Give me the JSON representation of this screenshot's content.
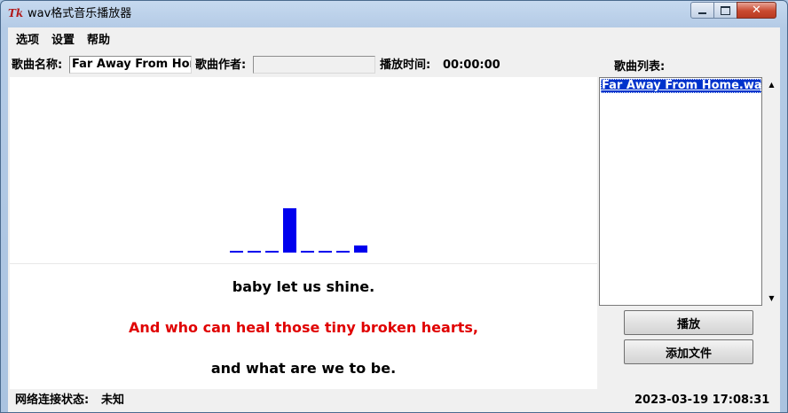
{
  "window": {
    "title": "wav格式音乐播放器",
    "app_icon_glyph": "Tk",
    "close_glyph": "✕"
  },
  "menu": {
    "items": [
      "选项",
      "设置",
      "帮助"
    ]
  },
  "info": {
    "song_name_label": "歌曲名称:",
    "song_name_value": "Far Away From Home.wav",
    "artist_label": "歌曲作者:",
    "artist_value": "",
    "play_time_label": "播放时间:",
    "play_time_value": "00:00:00",
    "playlist_label": "歌曲列表:"
  },
  "visualizer": {
    "bar_color": "#0000ee",
    "levels": [
      0.04,
      0.04,
      0.04,
      1.0,
      0.04,
      0.04,
      0.04,
      0.16
    ]
  },
  "lyrics": [
    {
      "text": "baby let us shine.",
      "color": "#000000"
    },
    {
      "text": "And who can heal those tiny broken hearts,",
      "color": "#e00000"
    },
    {
      "text": "and what are we to be.",
      "color": "#000000"
    }
  ],
  "playlist": {
    "items": [
      "Far Away From Home.wav"
    ],
    "selected_index": 0
  },
  "buttons": {
    "play": "播放",
    "add_file": "添加文件"
  },
  "status": {
    "network_label": "网络连接状态:",
    "network_value": "未知",
    "datetime": "2023-03-19 17:08:31"
  }
}
